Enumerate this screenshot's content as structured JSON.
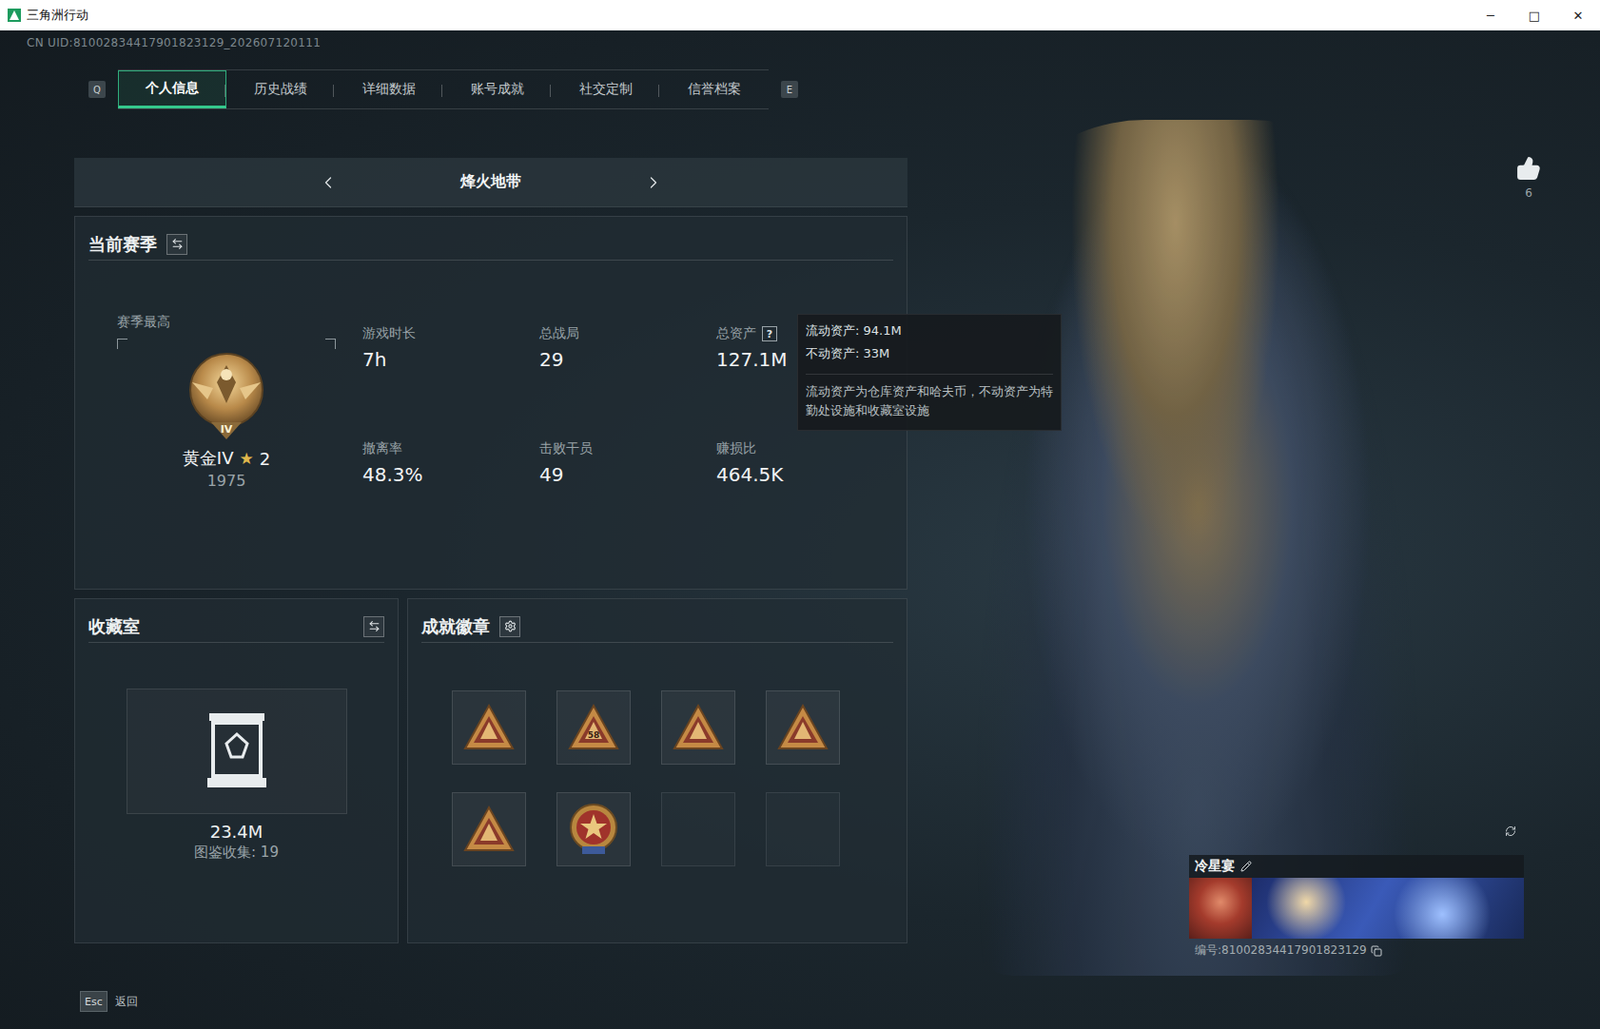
{
  "window": {
    "title": "三角洲行动",
    "controls": [
      "─",
      "□",
      "✕"
    ]
  },
  "uid": "CN UID:81002834417901823129_202607120111",
  "tabs": {
    "prev_key": "Q",
    "next_key": "E",
    "items": [
      {
        "label": "个人信息",
        "selected": true
      },
      {
        "label": "历史战绩",
        "selected": false
      },
      {
        "label": "详细数据",
        "selected": false
      },
      {
        "label": "账号成就",
        "selected": false
      },
      {
        "label": "社交定制",
        "selected": false
      },
      {
        "label": "信誉档案",
        "selected": false
      }
    ]
  },
  "mode": {
    "label": "烽火地带"
  },
  "season": {
    "title": "当前赛季",
    "rank": {
      "caption": "赛季最高",
      "numeral": "IV",
      "name": "黄金IV",
      "star": "★",
      "stars": "2",
      "score": "1975"
    },
    "stats": [
      {
        "label": "游戏时长",
        "value": "7h",
        "help": ""
      },
      {
        "label": "总战局",
        "value": "29",
        "help": ""
      },
      {
        "label": "总资产",
        "value": "127.1M",
        "help": "?"
      },
      {
        "label": "撤离率",
        "value": "48.3%",
        "help": ""
      },
      {
        "label": "击败干员",
        "value": "49",
        "help": ""
      },
      {
        "label": "赚损比",
        "value": "464.5K",
        "help": ""
      }
    ]
  },
  "tooltip": {
    "lines": [
      "流动资产: 94.1M",
      "不动资产: 33M"
    ],
    "note": "流动资产为仓库资产和哈夫币，不动资产为特勤处设施和收藏室设施"
  },
  "collection": {
    "title": "收藏室",
    "value": "23.4M",
    "caption": "图鉴收集: 19"
  },
  "achievements": {
    "title": "成就徽章",
    "badges": [
      {
        "kind": "triangle",
        "text": ""
      },
      {
        "kind": "triangle",
        "text": "58"
      },
      {
        "kind": "triangle",
        "text": ""
      },
      {
        "kind": "triangle",
        "text": ""
      },
      {
        "kind": "triangle",
        "text": ""
      },
      {
        "kind": "medal",
        "text": ""
      },
      {
        "kind": "empty",
        "text": ""
      },
      {
        "kind": "empty",
        "text": ""
      }
    ]
  },
  "likes": {
    "count": "6"
  },
  "player": {
    "name": "冷星宴",
    "id": "编号:81002834417901823129"
  },
  "back": {
    "key": "Esc",
    "label": "返回"
  }
}
